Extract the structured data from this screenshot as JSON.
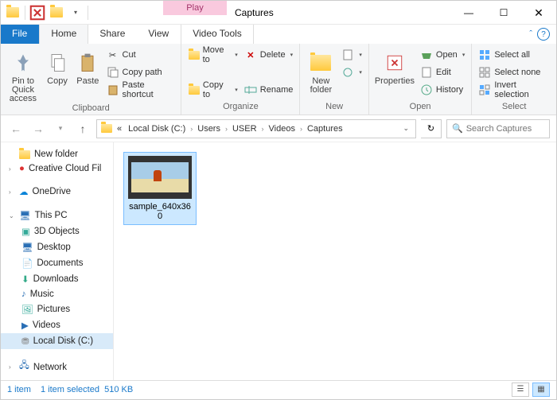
{
  "title": "Captures",
  "context_tab": {
    "play": "Play",
    "group": "Video Tools"
  },
  "tabs": {
    "file": "File",
    "home": "Home",
    "share": "Share",
    "view": "View"
  },
  "ribbon": {
    "clipboard": {
      "label": "Clipboard",
      "pin": "Pin to Quick\naccess",
      "copy": "Copy",
      "paste": "Paste",
      "cut": "Cut",
      "copy_path": "Copy path",
      "paste_shortcut": "Paste shortcut"
    },
    "organize": {
      "label": "Organize",
      "move_to": "Move to",
      "copy_to": "Copy to",
      "delete": "Delete",
      "rename": "Rename"
    },
    "new": {
      "label": "New",
      "new_folder": "New\nfolder"
    },
    "open": {
      "label": "Open",
      "properties": "Properties",
      "open": "Open",
      "edit": "Edit",
      "history": "History"
    },
    "select": {
      "label": "Select",
      "select_all": "Select all",
      "select_none": "Select none",
      "invert": "Invert selection"
    }
  },
  "breadcrumbs": [
    "Local Disk (C:)",
    "Users",
    "USER",
    "Videos",
    "Captures"
  ],
  "search_placeholder": "Search Captures",
  "tree": {
    "new_folder": "New folder",
    "creative_cloud": "Creative Cloud Fil",
    "onedrive": "OneDrive",
    "this_pc": "This PC",
    "objects3d": "3D Objects",
    "desktop": "Desktop",
    "documents": "Documents",
    "downloads": "Downloads",
    "music": "Music",
    "pictures": "Pictures",
    "videos": "Videos",
    "local_disk": "Local Disk (C:)",
    "network": "Network"
  },
  "file": {
    "name": "sample_640x360"
  },
  "status": {
    "count": "1 item",
    "selected": "1 item selected",
    "size": "510 KB"
  }
}
